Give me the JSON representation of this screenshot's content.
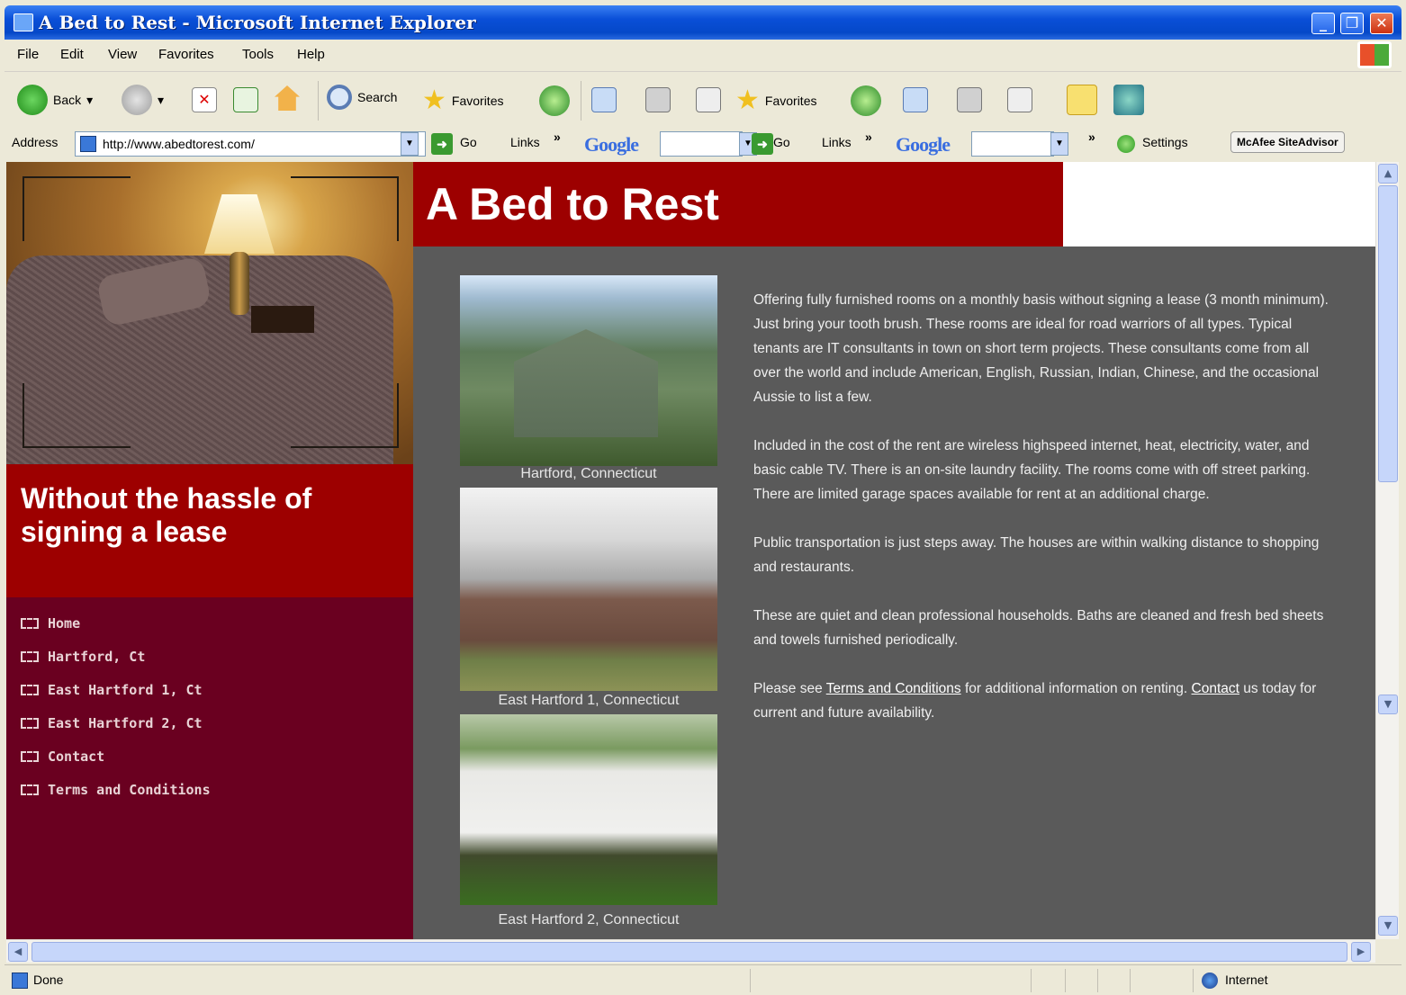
{
  "window": {
    "title": "A Bed to Rest - Microsoft Internet Explorer"
  },
  "menu": [
    "File",
    "Edit",
    "View",
    "Favorites",
    "Tools",
    "Help"
  ],
  "toolbar": {
    "back": "Back",
    "search": "Search",
    "favorites": "Favorites",
    "favorites2": "Favorites"
  },
  "addressbar": {
    "label": "Address",
    "url": "http://www.abedtorest.com/",
    "go": "Go",
    "links": "Links",
    "go2": "Go",
    "links2": "Links",
    "google": "Google",
    "google2": "Google",
    "settings": "Settings",
    "mcafee": "McAfee SiteAdvisor"
  },
  "site": {
    "title": "A Bed to Rest",
    "tagline": "Without the hassle of signing a lease",
    "nav": [
      "Home",
      "Hartford, Ct",
      "East Hartford 1, Ct",
      "East Hartford 2, Ct",
      "Contact",
      "Terms and Conditions"
    ],
    "captions": [
      "Hartford, Connecticut",
      "East Hartford 1, Connecticut",
      "East Hartford 2, Connecticut"
    ],
    "p1": "Offering fully furnished rooms on a monthly basis without signing a lease (3 month minimum).   Just bring your tooth brush.  These rooms are ideal for road warriors of all types.  Typical tenants are IT consultants in town on short term projects.    These consultants come from all over the world and include American, English, Russian, Indian, Chinese, and the occasional Aussie to list a few.",
    "p2": "Included in the cost of the rent are wireless highspeed internet, heat, electricity, water, and basic cable TV.  There is an on-site laundry facility.  The rooms come with off street parking.  There are limited garage spaces available for rent at an additional charge.",
    "p3": "Public transportation is just steps away.  The houses are within walking distance to shopping and restaurants.",
    "p4": "These are quiet and clean professional households.  Baths are cleaned and fresh bed sheets and towels furnished periodically.",
    "p5_a": "Please see ",
    "p5_link1": "Terms and Conditions",
    "p5_b": " for additional information on renting.  ",
    "p5_link2": "Contact",
    "p5_c": " us today for current and future availability."
  },
  "status": {
    "left": "Done",
    "zone": "Internet"
  }
}
